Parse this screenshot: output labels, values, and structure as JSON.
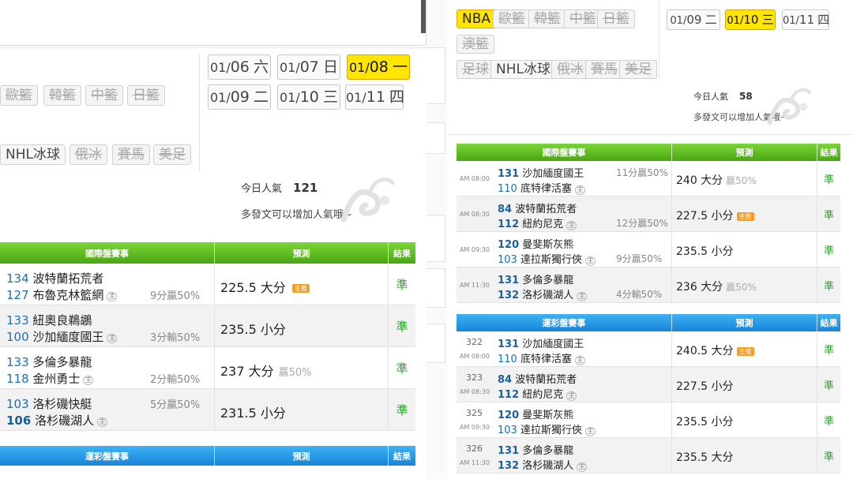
{
  "left": {
    "dates": [
      {
        "md": "01/",
        "d": "06",
        "wd": "六"
      },
      {
        "md": "01/",
        "d": "07",
        "wd": "日"
      },
      {
        "md": "01/",
        "d": "08",
        "wd": "一"
      },
      {
        "md": "01/",
        "d": "09",
        "wd": "二"
      },
      {
        "md": "01/",
        "d": "10",
        "wd": "三"
      },
      {
        "md": "01/",
        "d": "11",
        "wd": "四"
      }
    ],
    "categories": [
      "歐籃",
      "韓籃",
      "中籃",
      "日籃",
      "NHL冰球",
      "俄冰",
      "賽馬",
      "美足"
    ],
    "popularity": {
      "label": "今日人氣",
      "value": "121",
      "note": "多發文可以增加人氣哦~"
    },
    "intl_table": {
      "headers": [
        "國際盤賽事",
        "預測",
        "結果"
      ],
      "rows": [
        {
          "a_num": "134",
          "a_name": "波特蘭拓荒者",
          "b_num": "127",
          "b_name": "布魯克林籃網",
          "home_mark": "主",
          "spread": "9分贏50%",
          "pred": "225.5 大分",
          "win": "",
          "hot": "主推",
          "result": "準"
        },
        {
          "a_num": "133",
          "a_name": "紐奧良鵜鶘",
          "b_num": "100",
          "b_name": "沙加緬度國王",
          "home_mark": "主",
          "spread": "3分輸50%",
          "pred": "235.5 小分",
          "win": "",
          "hot": "",
          "result": "準"
        },
        {
          "a_num": "133",
          "a_name": "多倫多暴龍",
          "b_num": "118",
          "b_name": "金州勇士",
          "home_mark": "主",
          "spread": "2分輸50%",
          "pred": "237 大分",
          "win": "贏50%",
          "hot": "",
          "result": "準"
        },
        {
          "a_num": "103",
          "a_name": "洛杉磯快艇",
          "b_num": "106",
          "b_name": "洛杉磯湖人",
          "home_mark": "主",
          "spread": "5分贏50%",
          "pred": "231.5 小分",
          "win": "",
          "hot": "",
          "result": "準"
        }
      ]
    },
    "lottery_table": {
      "headers": [
        "運彩盤賽事",
        "預測",
        "結果"
      ]
    }
  },
  "right": {
    "dates": [
      {
        "md": "01/",
        "d": "09",
        "wd": "二"
      },
      {
        "md": "01/",
        "d": "10",
        "wd": "三"
      },
      {
        "md": "01/",
        "d": "11",
        "wd": "四"
      }
    ],
    "categories": [
      "NBA",
      "歐籃",
      "韓籃",
      "中籃",
      "日籃",
      "澳籃",
      "足球",
      "NHL冰球",
      "俄冰",
      "賽馬",
      "美足"
    ],
    "popularity": {
      "label": "今日人氣",
      "value": "58",
      "note": "多發文可以增加人氣哦~"
    },
    "intl_table": {
      "headers": [
        "國際盤賽事",
        "預測",
        "結果"
      ],
      "rows": [
        {
          "time": "AM 08:00",
          "a_num": "131",
          "a_name": "沙加緬度國王",
          "b_num": "110",
          "b_name": "底特律活塞",
          "home_mark": "主",
          "spread": "11分贏50%",
          "spread_row": "a",
          "pred": "240 大分",
          "win": "贏50%",
          "hot": "",
          "result": "準"
        },
        {
          "time": "AM 08:30",
          "a_num": "84",
          "a_name": "波特蘭拓荒者",
          "b_num": "112",
          "b_name": "紐約尼克",
          "home_mark": "主",
          "spread": "12分贏50%",
          "spread_row": "b",
          "pred": "227.5 小分",
          "win": "",
          "hot": "主推",
          "result": "準"
        },
        {
          "time": "AM 09:30",
          "a_num": "120",
          "a_name": "曼斐斯灰熊",
          "b_num": "103",
          "b_name": "達拉斯獨行俠",
          "home_mark": "主",
          "spread": "9分贏50%",
          "spread_row": "b",
          "pred": "235.5 小分",
          "win": "",
          "hot": "",
          "result": "準"
        },
        {
          "time": "AM 11:30",
          "a_num": "131",
          "a_name": "多倫多暴龍",
          "b_num": "132",
          "b_name": "洛杉磯湖人",
          "home_mark": "主",
          "spread": "4分輸50%",
          "spread_row": "b",
          "pred": "236 大分",
          "win": "贏50%",
          "hot": "",
          "result": "準"
        }
      ]
    },
    "lottery_table": {
      "headers": [
        "運彩盤賽事",
        "預測",
        "結果"
      ],
      "rows": [
        {
          "gid": "322",
          "time": "AM 08:00",
          "a_num": "131",
          "a_name": "沙加緬度國王",
          "b_num": "110",
          "b_name": "底特律活塞",
          "home_mark": "主",
          "pred": "240.5 大分",
          "hot": "主推",
          "result": "準"
        },
        {
          "gid": "323",
          "time": "AM 08:30",
          "a_num": "84",
          "a_name": "波特蘭拓荒者",
          "b_num": "112",
          "b_name": "紐約尼克",
          "home_mark": "主",
          "pred": "227.5 小分",
          "hot": "",
          "result": "準"
        },
        {
          "gid": "325",
          "time": "AM 09:30",
          "a_num": "120",
          "a_name": "曼斐斯灰熊",
          "b_num": "103",
          "b_name": "達拉斯獨行俠",
          "home_mark": "主",
          "pred": "235.5 小分",
          "hot": "",
          "result": "準"
        },
        {
          "gid": "326",
          "time": "AM 11:30",
          "a_num": "131",
          "a_name": "多倫多暴龍",
          "b_num": "132",
          "b_name": "洛杉磯湖人",
          "home_mark": "主",
          "pred": "235.5 大分",
          "hot": "",
          "result": "準"
        }
      ]
    }
  },
  "colors": {
    "accent_yellow": "#ffe600",
    "header_green": "#4aa514",
    "header_blue": "#1784d6",
    "result_green": "#27a427",
    "team_number": "#1d6fb2"
  }
}
